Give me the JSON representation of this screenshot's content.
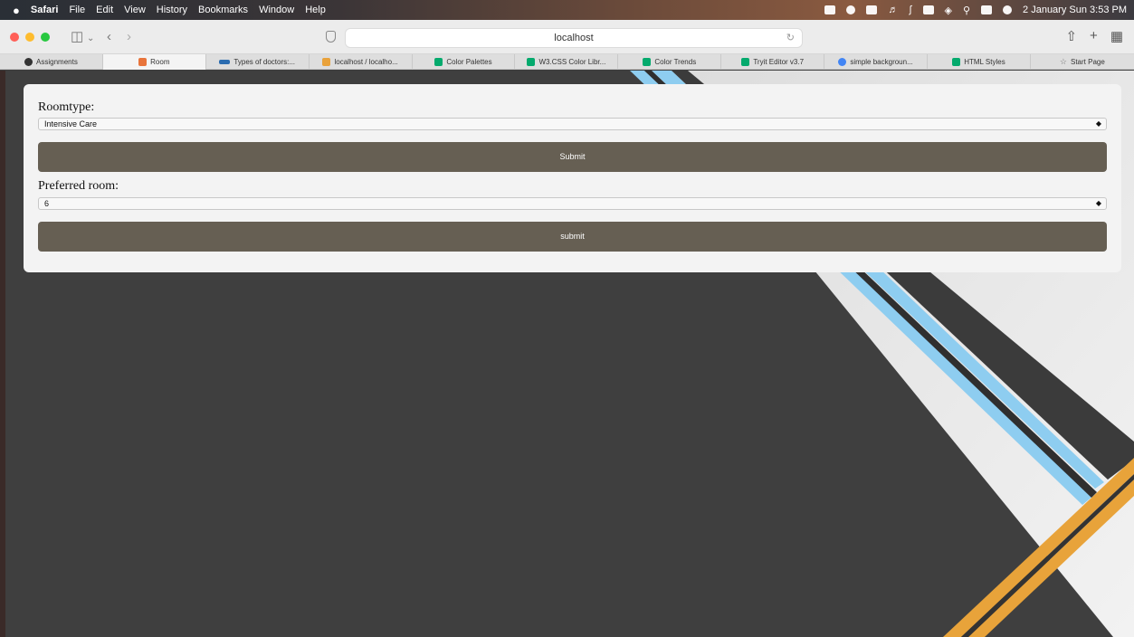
{
  "menubar": {
    "apple": "",
    "app": "Safari",
    "menus": [
      "File",
      "Edit",
      "View",
      "History",
      "Bookmarks",
      "Window",
      "Help"
    ],
    "clock": "2 January Sun  3:53 PM"
  },
  "toolbar": {
    "url": "localhost"
  },
  "tabs": [
    {
      "label": "Assignments",
      "icon_color": "#333333"
    },
    {
      "label": "Room",
      "icon_color": "#e8743b"
    },
    {
      "label": "Types of doctors:...",
      "icon_color": "#2b6cb0"
    },
    {
      "label": "localhost / localho...",
      "icon_color": "#e9a23b"
    },
    {
      "label": "Color Palettes",
      "icon_color": "#04aa6d"
    },
    {
      "label": "W3.CSS Color Libr...",
      "icon_color": "#04aa6d"
    },
    {
      "label": "Color Trends",
      "icon_color": "#04aa6d"
    },
    {
      "label": "Tryit Editor v3.7",
      "icon_color": "#04aa6d"
    },
    {
      "label": "simple backgroun...",
      "icon_color": "#4285f4"
    },
    {
      "label": "HTML Styles",
      "icon_color": "#04aa6d"
    },
    {
      "label": "Start Page",
      "icon_color": "#888888"
    }
  ],
  "form": {
    "roomtype_label": "Roomtype:",
    "roomtype_value": "Intensive Care",
    "submit1": "Submit",
    "preferred_label": "Preferred room:",
    "preferred_value": "6",
    "submit2": "submit"
  },
  "colors": {
    "button": "#665f53",
    "background": "#3f3f3f",
    "accent_blue": "#8ecdf0",
    "accent_orange": "#e8a33a"
  }
}
